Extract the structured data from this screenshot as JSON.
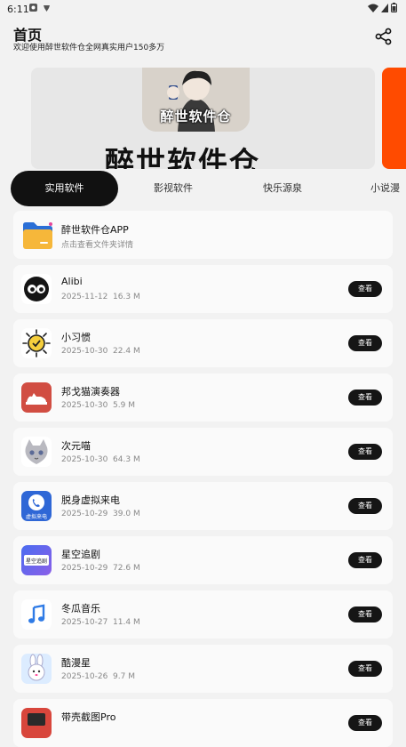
{
  "status_bar": {
    "time": "6:11"
  },
  "header": {
    "title": "首页",
    "subtitle": "欢迎使用醉世软件仓全网真实用户150多万"
  },
  "banner": {
    "art_text": "醉世软件仓",
    "big_text": "醉世软件仓"
  },
  "tabs": [
    {
      "label": "实用软件"
    },
    {
      "label": "影视软件"
    },
    {
      "label": "快乐源泉"
    },
    {
      "label": "小说漫"
    }
  ],
  "featured": {
    "name": "醉世软件仓APP",
    "desc": "点击查看文件夹详情"
  },
  "view_label": "查看",
  "apps": [
    {
      "name": "Alibi",
      "date": "2025-11-12",
      "size": "16.3 M"
    },
    {
      "name": "小习惯",
      "date": "2025-10-30",
      "size": "22.4 M"
    },
    {
      "name": "邦戈猫演奏器",
      "date": "2025-10-30",
      "size": "5.9 M"
    },
    {
      "name": "次元喵",
      "date": "2025-10-30",
      "size": "64.3 M"
    },
    {
      "name": "脱身虚拟来电",
      "date": "2025-10-29",
      "size": "39.0 M"
    },
    {
      "name": "星空追剧",
      "date": "2025-10-29",
      "size": "72.6 M"
    },
    {
      "name": "冬瓜音乐",
      "date": "2025-10-27",
      "size": "11.4 M"
    },
    {
      "name": "酷漫星",
      "date": "2025-10-26",
      "size": "9.7 M"
    },
    {
      "name": "带壳截图Pro",
      "date": "",
      "size": ""
    }
  ],
  "icon_text": {
    "fake_call": "虚拟来电",
    "star_drama": "星空追剧"
  },
  "colors": {
    "accent": "#111111",
    "banner_next": "#ff4b00",
    "background": "#f2f2f2"
  }
}
